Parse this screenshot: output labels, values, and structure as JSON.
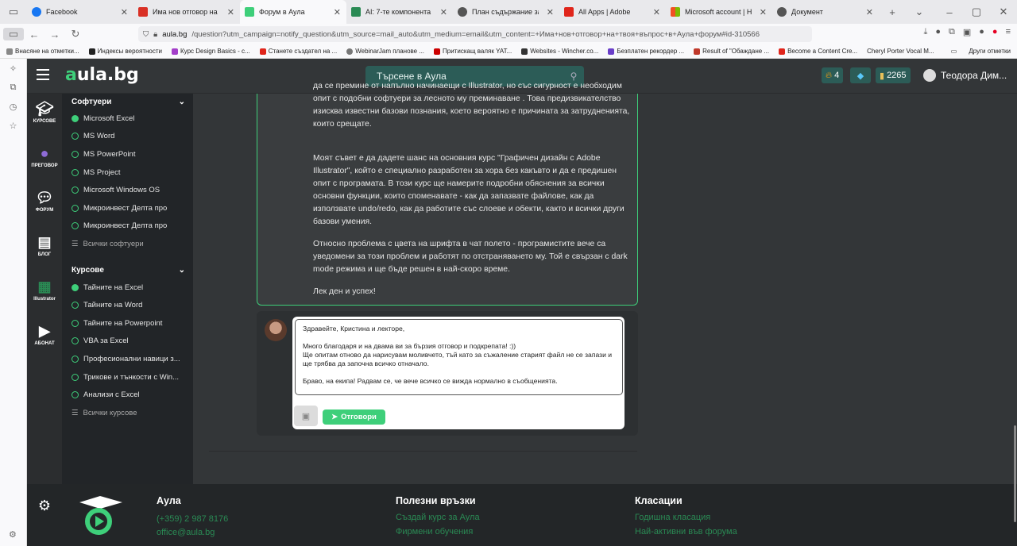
{
  "browser": {
    "tabs": [
      {
        "title": "Facebook",
        "color": "#1877f2"
      },
      {
        "title": "Има нов отговор на твоя...",
        "color": "#d93025"
      },
      {
        "title": "Форум в Аула",
        "color": "#3ecf7a"
      },
      {
        "title": "AI: 7-те компонента на пе...",
        "color": "#2a8a54"
      },
      {
        "title": "План съдържание за книг...",
        "color": "#555555"
      },
      {
        "title": "All Apps | Adobe",
        "color": "#e0251b"
      },
      {
        "title": "Microsoft account | Начало",
        "color": "#f25022"
      },
      {
        "title": "Документ",
        "color": "#555555"
      }
    ],
    "url_host": "aula.bg",
    "url_rest": "/question?utm_campaign=notify_question&utm_source=mail_auto&utm_medium=email&utm_content=+Има+нов+отговор+на+твоя+въпрос+в+Аула+форум#id-310566",
    "bookmarks": [
      "Внасяне на отметки...",
      "Индексы вероятности",
      "Курс Design Basics - с...",
      "Станете създател на ...",
      "WebinarJam планове ...",
      "Притискащ валяк YAT...",
      "Websites - Wincher.co...",
      "Безплатен рекордер ...",
      "Result of \"Обаждане ...",
      "Become a Content Cre...",
      "Cheryl Porter Vocal M..."
    ],
    "other_bookmarks": "Други отметки"
  },
  "header": {
    "logo_a": "a",
    "logo_rest": "ula.bg",
    "search_placeholder": "Търсене в Аула",
    "fire": "4",
    "coins": "2265",
    "user": "Теодора Дим..."
  },
  "rail": [
    "КУРСОВЕ",
    "ПРЕГОВОР",
    "ФОРУМ",
    "БЛОГ",
    "Illustrator",
    "АБОНАТ"
  ],
  "sidebar": {
    "software_title": "Софтуери",
    "software": [
      "Microsoft Excel",
      "MS Word",
      "MS PowerPoint",
      "MS Project",
      "Microsoft Windows OS",
      "Микроинвест Делта про",
      "Микроинвест Делта про"
    ],
    "all_software": "Всички софтуери",
    "courses_title": "Курсове",
    "courses": [
      "Тайните на Excel",
      "Тайните на Word",
      "Тайните на Powerpoint",
      "VBA за Excel",
      "Професионални навици з...",
      "Трикове и тънкости с Win...",
      "Анализи с Excel"
    ],
    "all_courses": "Всички курсове"
  },
  "answer": {
    "p1": "да се премине от напълно начинаещи с Illustrator, но със сигурност е необходим опит с подобни софтуери за лесното му преминаване . Това предизвикателство изисква известни базови познания, което вероятно е причината за затрудненията, които срещате.",
    "p2": "Моят съвет е да дадете шанс на основния курс \"Графичен дизайн с Adobe Illustrator\", който е специално разработен за хора без какъвто и да е предишен опит с програмата. В този курс ще намерите подробни обяснения за всички основни функции, които споменавате - как да запазвате файлове, как да използвате undo/redo, как да работите със слоеве и обекти, както и всички други базови умения.",
    "p3": "Относно проблема с цвета на шрифта в чат полето - програмистите вече са уведомени за този проблем и работят по отстраняването му. Той е свързан с dark mode режима и ще бъде решен в най-скоро време.",
    "p4": "Лек ден и успех!"
  },
  "reply": {
    "text": "Здравейте, Кристина и лекторе,\n\nМного благодаря и на двама ви за бързия отговор и подкрепата! :))\nЩе опитам отново да нарисувам моливчето, тъй като за съжаление старият файл не се запази и ще трябва да започна всичко отначало.\n\nБраво, на екипа! Радвам се, че вече всичко се вижда нормално в съобщенията.",
    "send_label": "Отговори"
  },
  "footer": {
    "col1_title": "Аула",
    "phone": "(+359) 2 987 8176",
    "email": "office@aula.bg",
    "col2_title": "Полезни връзки",
    "col2_links": [
      "Създай курс за Аула",
      "Фирмени обучения"
    ],
    "col3_title": "Класации",
    "col3_links": [
      "Годишна класация",
      "Най-активни във форума"
    ]
  },
  "colors": {
    "accent": "#3ecf7a",
    "bg": "#333638",
    "sidebar": "#222528"
  }
}
